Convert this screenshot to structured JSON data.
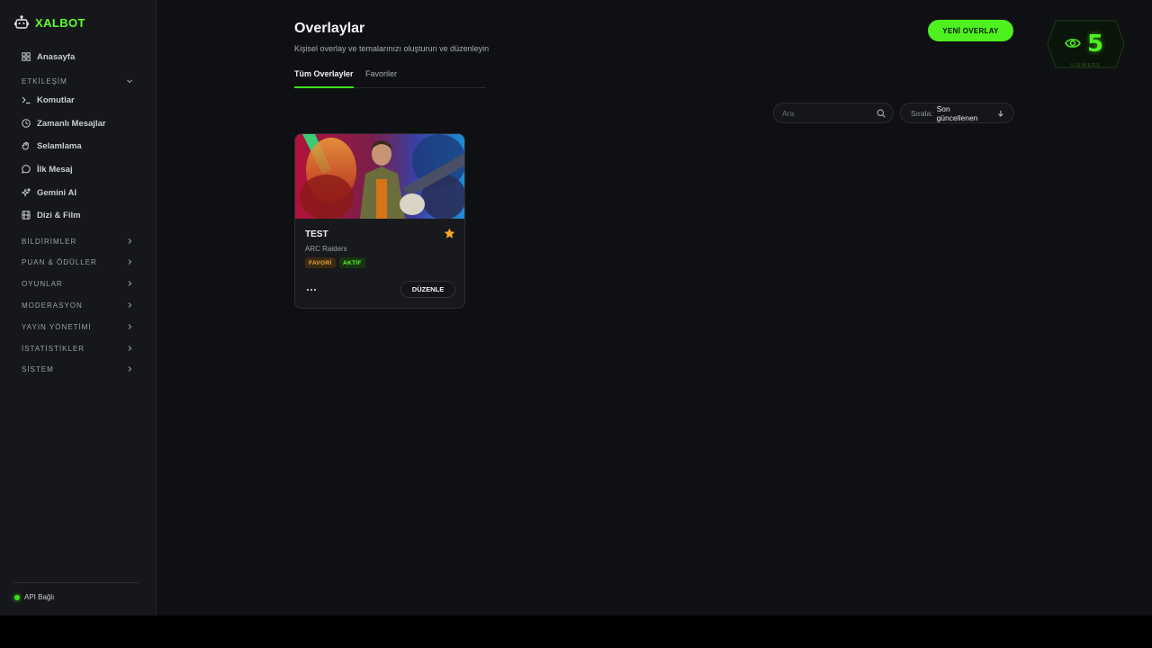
{
  "brand": {
    "name": "XALBOT",
    "icon": "robot-icon",
    "accent": "#5dff2e"
  },
  "sidebar": {
    "home": {
      "label": "Anasayfa",
      "icon": "grid-icon"
    },
    "interaction": {
      "label": "ETKİLEŞİM",
      "items": [
        {
          "label": "Komutlar",
          "icon": "terminal-icon"
        },
        {
          "label": "Zamanlı Mesajlar",
          "icon": "clock-icon"
        },
        {
          "label": "Selamlama",
          "icon": "wave-hand-icon"
        },
        {
          "label": "İlk Mesaj",
          "icon": "chat-bubble-icon"
        },
        {
          "label": "Gemini AI",
          "icon": "sparkles-icon"
        },
        {
          "label": "Dizi & Film",
          "icon": "film-icon"
        }
      ]
    },
    "sections": [
      {
        "label": "BİLDİRİMLER"
      },
      {
        "label": "PUAN & ÖDÜLLER"
      },
      {
        "label": "OYUNLAR"
      },
      {
        "label": "MODERASYON"
      },
      {
        "label": "YAYIN YÖNETİMİ"
      },
      {
        "label": "İSTATİSTİKLER"
      },
      {
        "label": "SİSTEM"
      }
    ],
    "api_status": {
      "label": "API Bağlı",
      "color": "#3ddc1a"
    }
  },
  "header": {
    "title": "Overlaylar",
    "subtitle": "Kişisel overlay ve temalarınızı oluşturun ve düzenleyin",
    "new_button": "YENİ OVERLAY",
    "tabs": [
      {
        "label": "Tüm Overlayler",
        "active": true
      },
      {
        "label": "Favoriler",
        "active": false
      }
    ]
  },
  "viewers": {
    "count": "5",
    "label": "VIEWERS"
  },
  "toolbar": {
    "search_placeholder": "Ara",
    "sort_label": "Sırala:",
    "sort_value": "Son güncellenen"
  },
  "cards": [
    {
      "title": "TEST",
      "subtitle": "ARC Raiders",
      "favorite": true,
      "tags": [
        "FAVORİ",
        "AKTİF"
      ],
      "edit_label": "DÜZENLE"
    }
  ]
}
